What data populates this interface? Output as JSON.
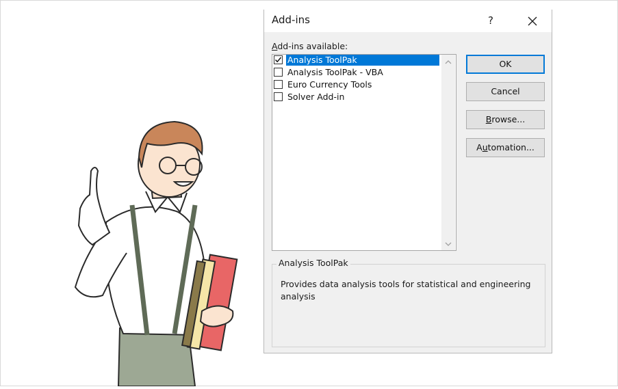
{
  "dialog": {
    "title": "Add-ins",
    "help_glyph": "?",
    "available_label_underlined": "A",
    "available_label_rest": "dd-ins available:",
    "addins": [
      {
        "label": "Analysis ToolPak",
        "checked": true,
        "selected": true
      },
      {
        "label": "Analysis ToolPak - VBA",
        "checked": false,
        "selected": false
      },
      {
        "label": "Euro Currency Tools",
        "checked": false,
        "selected": false
      },
      {
        "label": "Solver Add-in",
        "checked": false,
        "selected": false
      }
    ],
    "buttons": {
      "ok": "OK",
      "cancel": "Cancel",
      "browse_underlined": "B",
      "browse_rest": "rowse...",
      "automation_pre": "A",
      "automation_underlined": "u",
      "automation_rest": "tomation..."
    },
    "description": {
      "caption": "Analysis ToolPak",
      "text": "Provides data analysis tools for statistical and engineering analysis"
    }
  },
  "colors": {
    "selection": "#0078d7",
    "dialog_bg": "#f0f0f0"
  },
  "icons": {
    "close": "close-icon",
    "help": "help-icon",
    "scroll_up": "chevron-up-icon",
    "scroll_down": "chevron-down-icon"
  }
}
